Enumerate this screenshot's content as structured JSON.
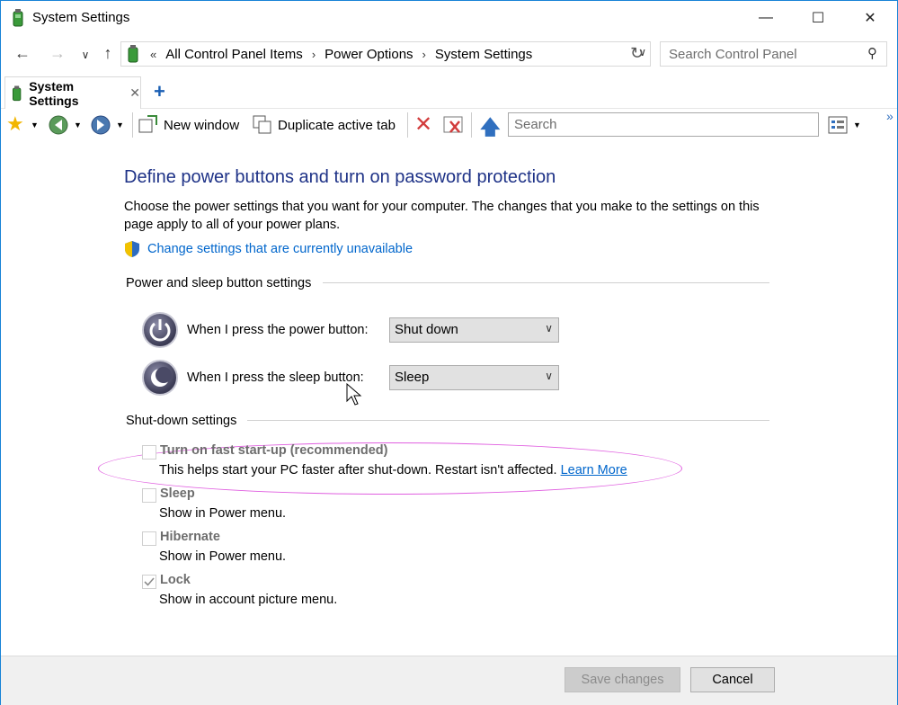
{
  "window": {
    "title": "System Settings"
  },
  "address": {
    "crumbs": [
      "All Control Panel Items",
      "Power Options",
      "System Settings"
    ],
    "search_placeholder": "Search Control Panel"
  },
  "tabs": [
    {
      "label": "System Settings"
    }
  ],
  "toolbar": {
    "new_window": "New window",
    "duplicate_tab": "Duplicate active tab",
    "search_placeholder": "Search"
  },
  "page": {
    "heading": "Define power buttons and turn on password protection",
    "description": "Choose the power settings that you want for your computer. The changes that you make to the settings on this page apply to all of your power plans.",
    "change_link": "Change settings that are currently unavailable",
    "power_section": "Power and sleep button settings",
    "power_button_label": "When I press the power button:",
    "power_button_value": "Shut down",
    "sleep_button_label": "When I press the sleep button:",
    "sleep_button_value": "Sleep",
    "shutdown_section": "Shut-down settings",
    "options": [
      {
        "title": "Turn on fast start-up (recommended)",
        "desc": "This helps start your PC faster after shut-down. Restart isn't affected.",
        "link": "Learn More",
        "checked": false
      },
      {
        "title": "Sleep",
        "desc": "Show in Power menu.",
        "checked": false
      },
      {
        "title": "Hibernate",
        "desc": "Show in Power menu.",
        "checked": false
      },
      {
        "title": "Lock",
        "desc": "Show in account picture menu.",
        "checked": true
      }
    ]
  },
  "footer": {
    "save": "Save changes",
    "cancel": "Cancel"
  }
}
